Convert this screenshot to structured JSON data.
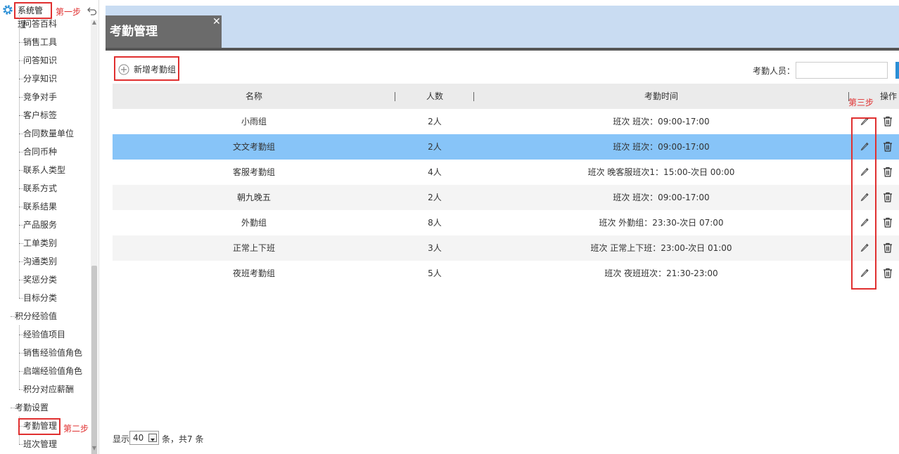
{
  "sidebar": {
    "title": "系统管理",
    "step1": "第一步",
    "step2": "第二步",
    "items": [
      {
        "label": "问答百科",
        "level": 2
      },
      {
        "label": "销售工具",
        "level": 2
      },
      {
        "label": "问答知识",
        "level": 2
      },
      {
        "label": "分享知识",
        "level": 2
      },
      {
        "label": "竞争对手",
        "level": 2
      },
      {
        "label": "客户标签",
        "level": 2
      },
      {
        "label": "合同数量单位",
        "level": 2
      },
      {
        "label": "合同币种",
        "level": 2
      },
      {
        "label": "联系人类型",
        "level": 2
      },
      {
        "label": "联系方式",
        "level": 2
      },
      {
        "label": "联系结果",
        "level": 2
      },
      {
        "label": "产品服务",
        "level": 2
      },
      {
        "label": "工单类别",
        "level": 2
      },
      {
        "label": "沟通类别",
        "level": 2
      },
      {
        "label": "奖惩分类",
        "level": 2
      },
      {
        "label": "目标分类",
        "level": 2
      },
      {
        "label": "积分经验值",
        "level": 1
      },
      {
        "label": "经验值项目",
        "level": 2
      },
      {
        "label": "销售经验值角色",
        "level": 2
      },
      {
        "label": "启端经验值角色",
        "level": 2
      },
      {
        "label": "积分对应薪酬",
        "level": 2
      },
      {
        "label": "考勤设置",
        "level": 1
      },
      {
        "label": "考勤管理",
        "level": 2
      },
      {
        "label": "班次管理",
        "level": 2
      }
    ]
  },
  "tab": {
    "title": "考勤管理",
    "close": "✕"
  },
  "toolbar": {
    "add_label": "新增考勤组",
    "filter_label": "考勤人员：",
    "filter_value": "",
    "filter_placeholder": ""
  },
  "table": {
    "headers": {
      "name": "名称",
      "count": "人数",
      "time": "考勤时间",
      "ops": "操作"
    },
    "step3": "第三步",
    "rows": [
      {
        "name": "小雨组",
        "count": "2人",
        "time": "班次 班次：09:00-17:00"
      },
      {
        "name": "文文考勤组",
        "count": "2人",
        "time": "班次 班次：09:00-17:00"
      },
      {
        "name": "客服考勤组",
        "count": "4人",
        "time": "班次 晚客服班次1：15:00-次日 00:00"
      },
      {
        "name": "朝九晚五",
        "count": "2人",
        "time": "班次 班次：09:00-17:00"
      },
      {
        "name": "外勤组",
        "count": "8人",
        "time": "班次 外勤组：23:30-次日 07:00"
      },
      {
        "name": "正常上下班",
        "count": "3人",
        "time": "班次 正常上下班：23:00-次日 01:00"
      },
      {
        "name": "夜班考勤组",
        "count": "5人",
        "time": "班次 夜班班次：21:30-23:00"
      }
    ],
    "selected_row": 1
  },
  "footer": {
    "show": "显示",
    "page_size": "40",
    "summary": "条，共7 条"
  },
  "colors": {
    "accent": "#2b8fd6",
    "selected_row": "#87c4f8",
    "highlight_box": "#e03030",
    "tabbar": "#c9dcf2"
  }
}
